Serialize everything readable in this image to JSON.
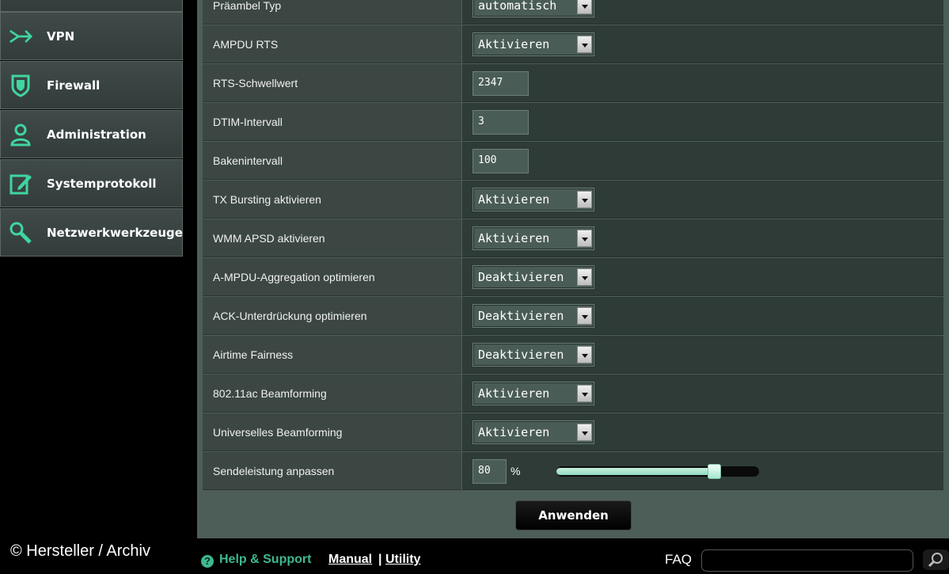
{
  "sidebar": {
    "items": [
      {
        "label": "",
        "icon": "nav-icon"
      },
      {
        "label": "VPN",
        "icon": "vpn-icon"
      },
      {
        "label": "Firewall",
        "icon": "shield-icon"
      },
      {
        "label": "Administration",
        "icon": "user-icon"
      },
      {
        "label": "Systemprotokoll",
        "icon": "log-edit-icon"
      },
      {
        "label": "Netzwerkwerkzeuge",
        "icon": "wrench-icon"
      }
    ]
  },
  "settings": {
    "rows": [
      {
        "label": "Präambel Typ",
        "type": "select",
        "value": "automatisch"
      },
      {
        "label": "AMPDU RTS",
        "type": "select",
        "value": "Aktivieren"
      },
      {
        "label": "RTS-Schwellwert",
        "type": "input",
        "value": "2347"
      },
      {
        "label": "DTIM-Intervall",
        "type": "input",
        "value": "3"
      },
      {
        "label": "Bakenintervall",
        "type": "input",
        "value": "100"
      },
      {
        "label": "TX Bursting aktivieren",
        "type": "select",
        "value": "Aktivieren"
      },
      {
        "label": "WMM APSD aktivieren",
        "type": "select",
        "value": "Aktivieren"
      },
      {
        "label": "A-MPDU-Aggregation optimieren",
        "type": "select",
        "value": "Deaktivieren"
      },
      {
        "label": "ACK-Unterdrückung optimieren",
        "type": "select",
        "value": "Deaktivieren"
      },
      {
        "label": "Airtime Fairness",
        "type": "select",
        "value": "Deaktivieren"
      },
      {
        "label": "802.11ac Beamforming",
        "type": "select",
        "value": "Aktivieren"
      },
      {
        "label": "Universelles Beamforming",
        "type": "select",
        "value": "Aktivieren"
      }
    ],
    "power": {
      "label": "Sendeleistung anpassen",
      "value": "80",
      "unit": "%",
      "level": 0.8
    }
  },
  "apply_label": "Anwenden",
  "footer": {
    "copyright": "© Hersteller / Archiv",
    "help_label": "Help & Support",
    "manual_label": "Manual",
    "separator": "|",
    "utility_label": "Utility",
    "faq_label": "FAQ"
  },
  "colors": {
    "accent": "#3fb88d",
    "panel": "#4d5e58",
    "row_label": "#3c4744",
    "row_value": "#2f3b37"
  }
}
